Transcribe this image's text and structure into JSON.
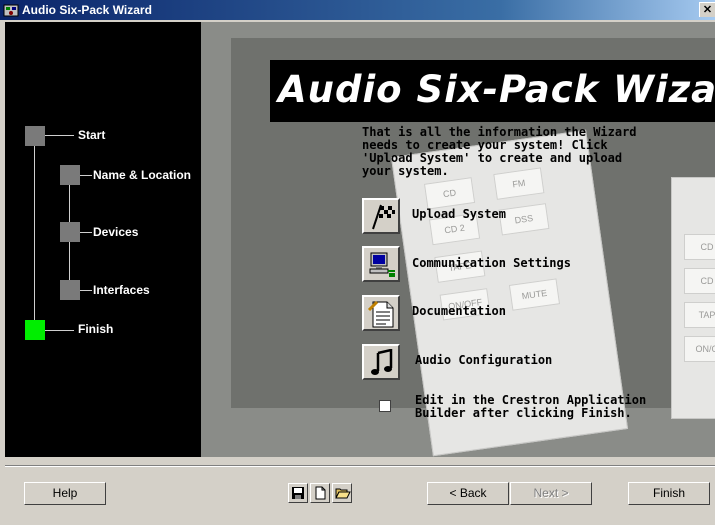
{
  "window": {
    "title": "Audio Six-Pack Wizard",
    "close_glyph": "✕"
  },
  "steps": [
    {
      "label": "Start",
      "state": "done"
    },
    {
      "label": "Name & Location",
      "state": "done"
    },
    {
      "label": "Devices",
      "state": "done"
    },
    {
      "label": "Interfaces",
      "state": "done"
    },
    {
      "label": "Finish",
      "state": "current"
    }
  ],
  "banner": {
    "title": "Audio Six-Pack Wizard"
  },
  "info_text": "That is all the information the Wizard needs to create your system! Click 'Upload System' to create and upload your system.",
  "actions": [
    {
      "label": "Upload System",
      "icon": "checkered-flag-icon"
    },
    {
      "label": "Communication Settings",
      "icon": "computer-network-icon"
    },
    {
      "label": "Documentation",
      "icon": "document-icon"
    },
    {
      "label": "Audio Configuration",
      "icon": "music-note-icon"
    }
  ],
  "checkbox": {
    "label": "Edit in the Crestron Application Builder after clicking Finish.",
    "checked": false
  },
  "background_keys": [
    "CD",
    "FM",
    "CD 2",
    "DSS",
    "TAPE",
    "ON/OFF",
    "MUTE"
  ],
  "background_side_keys": [
    "CD",
    "CD",
    "TAP",
    "ON/O"
  ],
  "footer": {
    "help": "Help",
    "back": "< Back",
    "next": "Next >",
    "finish": "Finish",
    "toolbar": [
      "save-icon",
      "new-file-icon",
      "open-folder-icon"
    ]
  },
  "colors": {
    "active_step": "#00ee00",
    "inactive_step": "#7a7a7a",
    "titlebar": "#0a246a"
  }
}
